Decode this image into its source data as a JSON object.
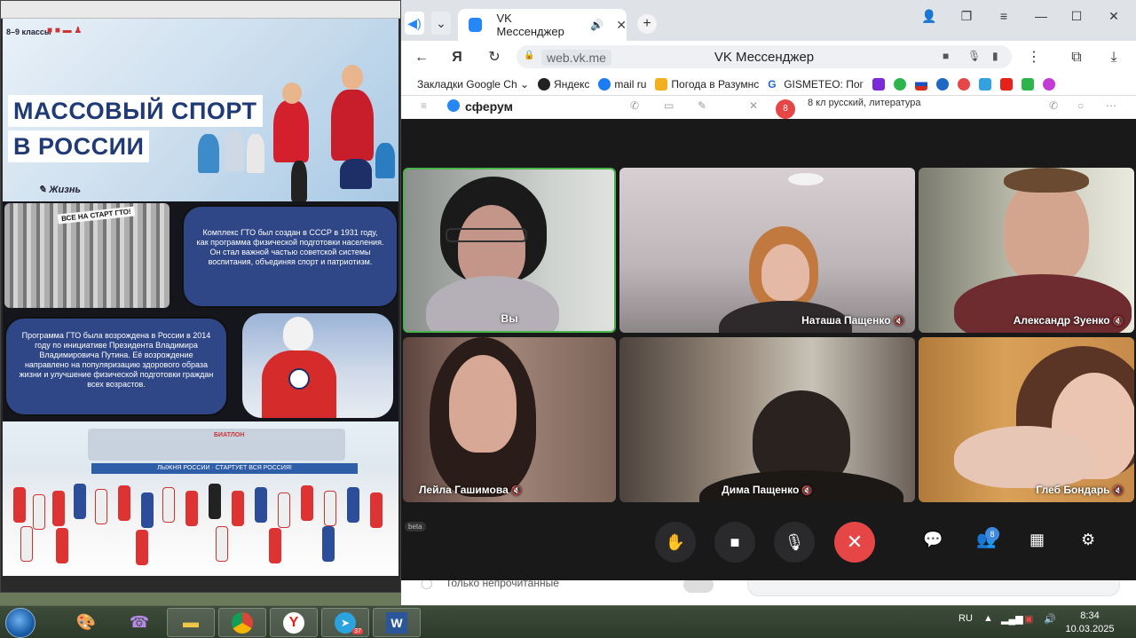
{
  "poster": {
    "classes": "8–9 классы",
    "title_line1": "МАССОВЫЙ СПОРТ",
    "title_line2": "В РОССИИ",
    "brand": "Жизнь",
    "banner": "ВСЕ НА СТАРТ ГТО!",
    "text1": "Комплекс ГТО был создан в СССР в 1931 году, как программа физической подготовки населения. Он стал важной частью советской системы воспитания, объединяя спорт и патриотизм.",
    "text2": "Программа ГТО была возрождена в России в 2014 году по инициативе Президента Владимира Владимировича Путина. Её возрождение направлено на популяризацию здорового образа жизни и улучшение физической подготовки граждан всех возрастов.",
    "ski_sign": "БИАТЛОН",
    "ski_banner": "ЛЫЖНЯ РОССИИ · СТАРТУЕТ ВСЯ РОССИЯ!"
  },
  "browser": {
    "tab_title": "VK Мессенджер",
    "host": "web.vk.me",
    "page_title": "VK Мессенджер",
    "bookmarks": [
      {
        "label": "Закладки Google Ch",
        "color": "#ffffff"
      },
      {
        "label": "Яндекс",
        "color": "#222222"
      },
      {
        "label": "mail ru",
        "color": "#1c7cf4"
      },
      {
        "label": "Погода в Разумнс",
        "color": "#f2b01e"
      },
      {
        "label": "GISMETEO: Пог",
        "color": "#1f68c4"
      }
    ]
  },
  "vk": {
    "brand": "сферум",
    "chat_badge": "8",
    "chat_title": "8 кл русский, литература",
    "unread_label": "Только непрочитанные",
    "beta": "beta"
  },
  "call": {
    "participants": [
      {
        "name": "Вы",
        "muted": false
      },
      {
        "name": "Наташа Пащенко",
        "muted": true
      },
      {
        "name": "Александр Зуенко",
        "muted": true
      },
      {
        "name": "Лейла Гашимова",
        "muted": true
      },
      {
        "name": "Дима Пащенко",
        "muted": true
      },
      {
        "name": "Глеб Бондарь",
        "muted": true
      }
    ],
    "participants_badge": "8"
  },
  "taskbar": {
    "lang": "RU",
    "time": "8:34",
    "date": "10.03.2025",
    "telegram_badge": "37"
  }
}
